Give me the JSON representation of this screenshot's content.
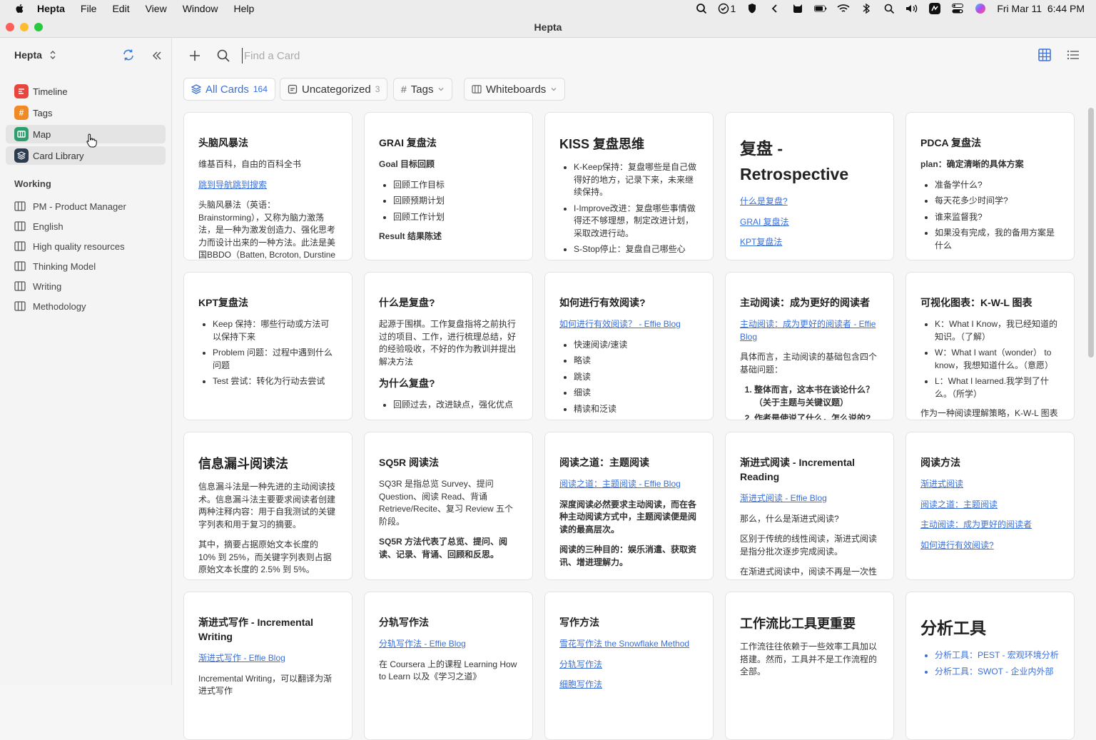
{
  "menubar": {
    "app": "Hepta",
    "items": [
      "File",
      "Edit",
      "View",
      "Window",
      "Help"
    ],
    "checks_count": "1",
    "datetime": "Fri Mar 11  6:44 PM"
  },
  "window": {
    "title": "Hepta"
  },
  "sidebar": {
    "workspace": "Hepta",
    "nav": [
      {
        "label": "Timeline",
        "color": "#e8453c",
        "glyph": "≡"
      },
      {
        "label": "Tags",
        "color": "#f08a24",
        "glyph": "#"
      },
      {
        "label": "Map",
        "color": "#2f9e6e",
        "glyph": "⊞"
      },
      {
        "label": "Card Library",
        "color": "#2d3b4e",
        "glyph": "◈"
      }
    ],
    "section_title": "Working",
    "working": [
      "PM - Product Manager",
      "English",
      "High quality resources",
      "Thinking Model",
      "Writing",
      "Methodology"
    ]
  },
  "toolbar": {
    "search_placeholder": "Find a Card"
  },
  "filters": {
    "all_cards": {
      "label": "All Cards",
      "count": "164"
    },
    "uncategorized": {
      "label": "Uncategorized",
      "count": "3"
    },
    "tags": {
      "label": "Tags"
    },
    "whiteboards": {
      "label": "Whiteboards"
    }
  },
  "cards": [
    {
      "title": "头脑风暴法",
      "blocks": [
        {
          "t": "p",
          "v": "维基百科，自由的百科全书"
        },
        {
          "t": "a",
          "v": "跳到导航跳到搜索"
        },
        {
          "t": "p",
          "v": "头脑风暴法（英语：Brainstorming），又称为脑力激荡法，是一种为激发创造力、强化思考力而设计出来的一种方法。此法是美国BBDO（Batten, Bcroton, Durstine and Osborn）广告公司创始人"
        }
      ]
    },
    {
      "title": "GRAI 复盘法",
      "blocks": [
        {
          "t": "pb",
          "v": "Goal 目标回顾"
        },
        {
          "t": "ul",
          "v": [
            "回顾工作目标",
            "回顾预期计划",
            "回顾工作计划"
          ]
        },
        {
          "t": "pb",
          "v": "Result 结果陈述"
        }
      ]
    },
    {
      "title": "KISS 复盘思维",
      "size": "big",
      "blocks": [
        {
          "t": "ul",
          "v": [
            "K-Keep保持：复盘哪些是自己做得好的地方，记录下来，未来继续保持。",
            "I-Improve改进：复盘哪些事情做得还不够理想，制定改进计划，采取改进行动。",
            "S-Stop停止：复盘自己哪些心"
          ]
        }
      ]
    },
    {
      "title": "复盘 - Retrospective",
      "size": "huge",
      "blocks": [
        {
          "t": "a",
          "v": "什么是复盘?"
        },
        {
          "t": "a",
          "v": "GRAI 复盘法"
        },
        {
          "t": "a",
          "v": "KPT复盘法"
        }
      ]
    },
    {
      "title": "PDCA 复盘法",
      "blocks": [
        {
          "t": "pb",
          "v": "plan：确定清晰的具体方案"
        },
        {
          "t": "ul",
          "v": [
            "准备学什么?",
            "每天花多少时间学?",
            "谁来监督我?",
            "如果没有完成，我的备用方案是什么"
          ]
        }
      ]
    },
    {
      "title": "KPT复盘法",
      "blocks": [
        {
          "t": "ul",
          "v": [
            "Keep 保持：哪些行动或方法可以保持下来",
            "Problem 问题：过程中遇到什么问题",
            "Test 尝试：转化为行动去尝试"
          ]
        }
      ]
    },
    {
      "title": "什么是复盘?",
      "blocks": [
        {
          "t": "p",
          "v": "起源于围棋。工作复盘指将之前执行过的项目、工作，进行梳理总结，好的经验吸收，不好的作为教训并提出解决方法"
        },
        {
          "t": "h4",
          "v": "为什么复盘?"
        },
        {
          "t": "ul",
          "v": [
            "回顾过去，改进缺点，强化优点"
          ]
        }
      ]
    },
    {
      "title": "如何进行有效阅读?",
      "blocks": [
        {
          "t": "a",
          "v": "如何进行有效阅读？ - Effie Blog"
        },
        {
          "t": "ul",
          "v": [
            "快速阅读/速读",
            "略读",
            "跳读",
            "细读",
            "精读和泛读"
          ]
        }
      ]
    },
    {
      "title": "主动阅读：成为更好的阅读者",
      "blocks": [
        {
          "t": "a",
          "v": "主动阅读：成为更好的阅读者 - Effie Blog"
        },
        {
          "t": "p",
          "v": "具体而言，主动阅读的基础包含四个基础问题："
        },
        {
          "t": "ol",
          "v": [
            "整体而言，这本书在谈论什么？（关于主题与关键议题）",
            "作者是使说了什么，怎么说的?"
          ]
        }
      ]
    },
    {
      "title": "可视化图表：K-W-L 图表",
      "blocks": [
        {
          "t": "ul",
          "v": [
            "K：What I Know，我已经知道的知识。（了解）",
            "W：What I want（wonder） to know，我想知道什么。（意愿）",
            "L：What I learned.我学到了什么。（所学）"
          ]
        },
        {
          "t": "p",
          "v": "作为一种阅读理解策略，K-W-L 图表"
        }
      ]
    },
    {
      "title": "信息漏斗阅读法",
      "size": "big",
      "blocks": [
        {
          "t": "p",
          "v": "信息漏斗法是一种先进的主动阅读技术。信息漏斗法主要要求阅读者创建两种注释内容：用于自我测试的关键字列表和用于复习的摘要。"
        },
        {
          "t": "p",
          "v": "其中，摘要占据原始文本长度的 10% 到 25%，而关键字列表则占据原始文本长度的 2.5% 到 5%。"
        }
      ]
    },
    {
      "title": "SQ5R 阅读法",
      "blocks": [
        {
          "t": "p",
          "v": "SQ3R 是指总览 Survey、提问 Question、阅读 Read、背诵 Retrieve/Recite、复习 Review 五个阶段。"
        },
        {
          "t": "pb",
          "v": "SQ5R 方法代表了总览、提问、阅读、记录、背诵、回顾和反思。"
        }
      ]
    },
    {
      "title": "阅读之道：主题阅读",
      "blocks": [
        {
          "t": "a",
          "v": "阅读之道：主题阅读 - Effie Blog"
        },
        {
          "t": "pb",
          "v": "深度阅读必然要求主动阅读，而在各种主动阅读方式中，主题阅读便是阅读的最高层次。"
        },
        {
          "t": "pb",
          "v": "阅读的三种目的：娱乐消遣、获取资讯、增进理解力。"
        }
      ]
    },
    {
      "title": "渐进式阅读 - Incremental Reading",
      "blocks": [
        {
          "t": "a",
          "v": "渐进式阅读 - Effie Blog"
        },
        {
          "t": "p",
          "v": "那么，什么是渐进式阅读?"
        },
        {
          "t": "p",
          "v": "区别于传统的线性阅读，渐进式阅读是指分批次逐步完成阅读。"
        },
        {
          "t": "p",
          "v": "在渐进式阅读中，阅读不再是一次性"
        }
      ]
    },
    {
      "title": "阅读方法",
      "blocks": [
        {
          "t": "a",
          "v": "渐进式阅读"
        },
        {
          "t": "a",
          "v": "阅读之道：主题阅读"
        },
        {
          "t": "a",
          "v": "主动阅读：成为更好的阅读者"
        },
        {
          "t": "a",
          "v": "如何进行有效阅读?"
        }
      ]
    },
    {
      "title": "渐进式写作 - Incremental Writing",
      "blocks": [
        {
          "t": "a",
          "v": "渐进式写作 - Effie Blog"
        },
        {
          "t": "p",
          "v": "Incremental Writing，可以翻译为渐进式写作"
        }
      ]
    },
    {
      "title": "分轨写作法",
      "blocks": [
        {
          "t": "a",
          "v": "分轨写作法 - Effie Blog"
        },
        {
          "t": "p",
          "v": "在 Coursera 上的课程 Learning How to Learn 以及《学习之道》"
        }
      ]
    },
    {
      "title": "写作方法",
      "blocks": [
        {
          "t": "a",
          "v": "雪花写作法 the Snowflake Method"
        },
        {
          "t": "a",
          "v": "分轨写作法"
        },
        {
          "t": "a",
          "v": "细胞写作法"
        }
      ]
    },
    {
      "title": "工作流比工具更重要",
      "size": "big",
      "blocks": [
        {
          "t": "p",
          "v": "工作流往往依赖于一些效率工具加以搭建。然而，工具并不是工作流程的全部。"
        }
      ]
    },
    {
      "title": "分析工具",
      "size": "huge",
      "blocks": [
        {
          "t": "ulink",
          "v": [
            "分析工具：PEST - 宏观环境分析",
            "分析工具：SWOT - 企业内外部"
          ]
        }
      ]
    }
  ]
}
